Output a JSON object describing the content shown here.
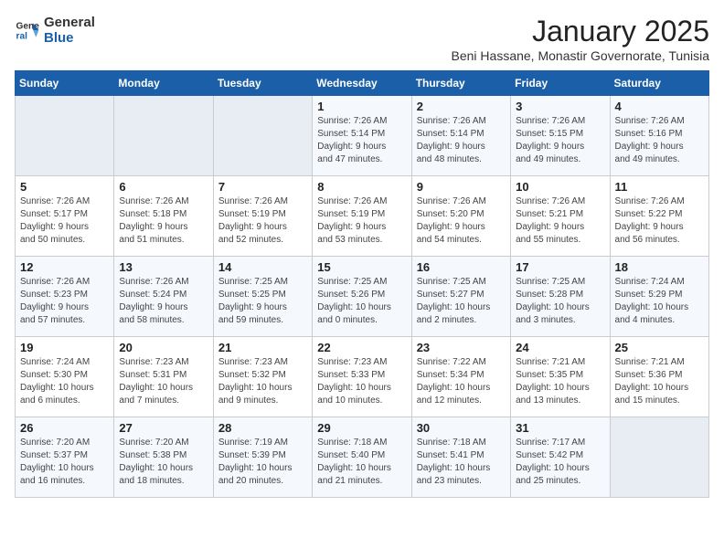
{
  "logo": {
    "line1": "General",
    "line2": "Blue"
  },
  "title": "January 2025",
  "subtitle": "Beni Hassane, Monastir Governorate, Tunisia",
  "days_header": [
    "Sunday",
    "Monday",
    "Tuesday",
    "Wednesday",
    "Thursday",
    "Friday",
    "Saturday"
  ],
  "weeks": [
    [
      {
        "num": "",
        "info": ""
      },
      {
        "num": "",
        "info": ""
      },
      {
        "num": "",
        "info": ""
      },
      {
        "num": "1",
        "info": "Sunrise: 7:26 AM\nSunset: 5:14 PM\nDaylight: 9 hours\nand 47 minutes."
      },
      {
        "num": "2",
        "info": "Sunrise: 7:26 AM\nSunset: 5:14 PM\nDaylight: 9 hours\nand 48 minutes."
      },
      {
        "num": "3",
        "info": "Sunrise: 7:26 AM\nSunset: 5:15 PM\nDaylight: 9 hours\nand 49 minutes."
      },
      {
        "num": "4",
        "info": "Sunrise: 7:26 AM\nSunset: 5:16 PM\nDaylight: 9 hours\nand 49 minutes."
      }
    ],
    [
      {
        "num": "5",
        "info": "Sunrise: 7:26 AM\nSunset: 5:17 PM\nDaylight: 9 hours\nand 50 minutes."
      },
      {
        "num": "6",
        "info": "Sunrise: 7:26 AM\nSunset: 5:18 PM\nDaylight: 9 hours\nand 51 minutes."
      },
      {
        "num": "7",
        "info": "Sunrise: 7:26 AM\nSunset: 5:19 PM\nDaylight: 9 hours\nand 52 minutes."
      },
      {
        "num": "8",
        "info": "Sunrise: 7:26 AM\nSunset: 5:19 PM\nDaylight: 9 hours\nand 53 minutes."
      },
      {
        "num": "9",
        "info": "Sunrise: 7:26 AM\nSunset: 5:20 PM\nDaylight: 9 hours\nand 54 minutes."
      },
      {
        "num": "10",
        "info": "Sunrise: 7:26 AM\nSunset: 5:21 PM\nDaylight: 9 hours\nand 55 minutes."
      },
      {
        "num": "11",
        "info": "Sunrise: 7:26 AM\nSunset: 5:22 PM\nDaylight: 9 hours\nand 56 minutes."
      }
    ],
    [
      {
        "num": "12",
        "info": "Sunrise: 7:26 AM\nSunset: 5:23 PM\nDaylight: 9 hours\nand 57 minutes."
      },
      {
        "num": "13",
        "info": "Sunrise: 7:26 AM\nSunset: 5:24 PM\nDaylight: 9 hours\nand 58 minutes."
      },
      {
        "num": "14",
        "info": "Sunrise: 7:25 AM\nSunset: 5:25 PM\nDaylight: 9 hours\nand 59 minutes."
      },
      {
        "num": "15",
        "info": "Sunrise: 7:25 AM\nSunset: 5:26 PM\nDaylight: 10 hours\nand 0 minutes."
      },
      {
        "num": "16",
        "info": "Sunrise: 7:25 AM\nSunset: 5:27 PM\nDaylight: 10 hours\nand 2 minutes."
      },
      {
        "num": "17",
        "info": "Sunrise: 7:25 AM\nSunset: 5:28 PM\nDaylight: 10 hours\nand 3 minutes."
      },
      {
        "num": "18",
        "info": "Sunrise: 7:24 AM\nSunset: 5:29 PM\nDaylight: 10 hours\nand 4 minutes."
      }
    ],
    [
      {
        "num": "19",
        "info": "Sunrise: 7:24 AM\nSunset: 5:30 PM\nDaylight: 10 hours\nand 6 minutes."
      },
      {
        "num": "20",
        "info": "Sunrise: 7:23 AM\nSunset: 5:31 PM\nDaylight: 10 hours\nand 7 minutes."
      },
      {
        "num": "21",
        "info": "Sunrise: 7:23 AM\nSunset: 5:32 PM\nDaylight: 10 hours\nand 9 minutes."
      },
      {
        "num": "22",
        "info": "Sunrise: 7:23 AM\nSunset: 5:33 PM\nDaylight: 10 hours\nand 10 minutes."
      },
      {
        "num": "23",
        "info": "Sunrise: 7:22 AM\nSunset: 5:34 PM\nDaylight: 10 hours\nand 12 minutes."
      },
      {
        "num": "24",
        "info": "Sunrise: 7:21 AM\nSunset: 5:35 PM\nDaylight: 10 hours\nand 13 minutes."
      },
      {
        "num": "25",
        "info": "Sunrise: 7:21 AM\nSunset: 5:36 PM\nDaylight: 10 hours\nand 15 minutes."
      }
    ],
    [
      {
        "num": "26",
        "info": "Sunrise: 7:20 AM\nSunset: 5:37 PM\nDaylight: 10 hours\nand 16 minutes."
      },
      {
        "num": "27",
        "info": "Sunrise: 7:20 AM\nSunset: 5:38 PM\nDaylight: 10 hours\nand 18 minutes."
      },
      {
        "num": "28",
        "info": "Sunrise: 7:19 AM\nSunset: 5:39 PM\nDaylight: 10 hours\nand 20 minutes."
      },
      {
        "num": "29",
        "info": "Sunrise: 7:18 AM\nSunset: 5:40 PM\nDaylight: 10 hours\nand 21 minutes."
      },
      {
        "num": "30",
        "info": "Sunrise: 7:18 AM\nSunset: 5:41 PM\nDaylight: 10 hours\nand 23 minutes."
      },
      {
        "num": "31",
        "info": "Sunrise: 7:17 AM\nSunset: 5:42 PM\nDaylight: 10 hours\nand 25 minutes."
      },
      {
        "num": "",
        "info": ""
      }
    ]
  ]
}
